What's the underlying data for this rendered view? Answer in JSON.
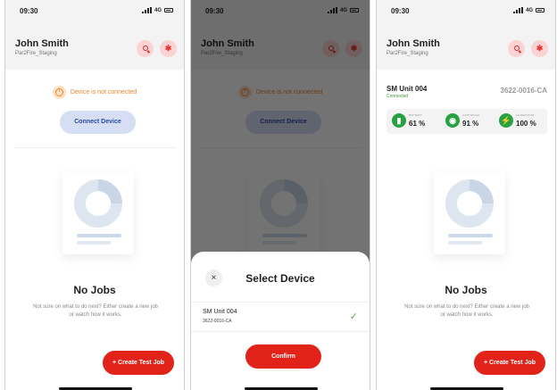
{
  "status_bar": {
    "time": "09:30",
    "network": "4G"
  },
  "header": {
    "user_name": "John Smith",
    "organization": "Par2Fire_Staging"
  },
  "screen1": {
    "notice": "Device is not connected",
    "connect_button": "Connect Device",
    "empty_title": "No Jobs",
    "empty_description": "Not sure on what to do next? Either create a new job or watch how it works.",
    "create_button": "+ Create Test Job"
  },
  "screen2": {
    "modal_title": "Select Device",
    "close_glyph": "×",
    "device_name": "SM Unit 004",
    "device_serial": "3622-0016-CA",
    "confirm_button": "Confirm"
  },
  "screen3": {
    "unit_name": "SM Unit 004",
    "unit_status": "Connected",
    "unit_serial": "3622-0016-CA",
    "metrics": [
      {
        "label": "BATTERY",
        "value": "61 %",
        "icon": "battery-icon"
      },
      {
        "label": "CARTRIDGE",
        "value": "91 %",
        "icon": "cartridge-icon"
      },
      {
        "label": "GENERATOR",
        "value": "100 %",
        "icon": "generator-icon"
      }
    ],
    "empty_title": "No Jobs",
    "empty_description": "Not sure on what to do next? Either create a new job or watch how it works.",
    "create_button": "+ Create Test Job"
  },
  "colors": {
    "accent_red": "#e2231a",
    "warning_orange": "#e8872c",
    "connected_green": "#27a243",
    "connect_blue": "#d5def3"
  }
}
